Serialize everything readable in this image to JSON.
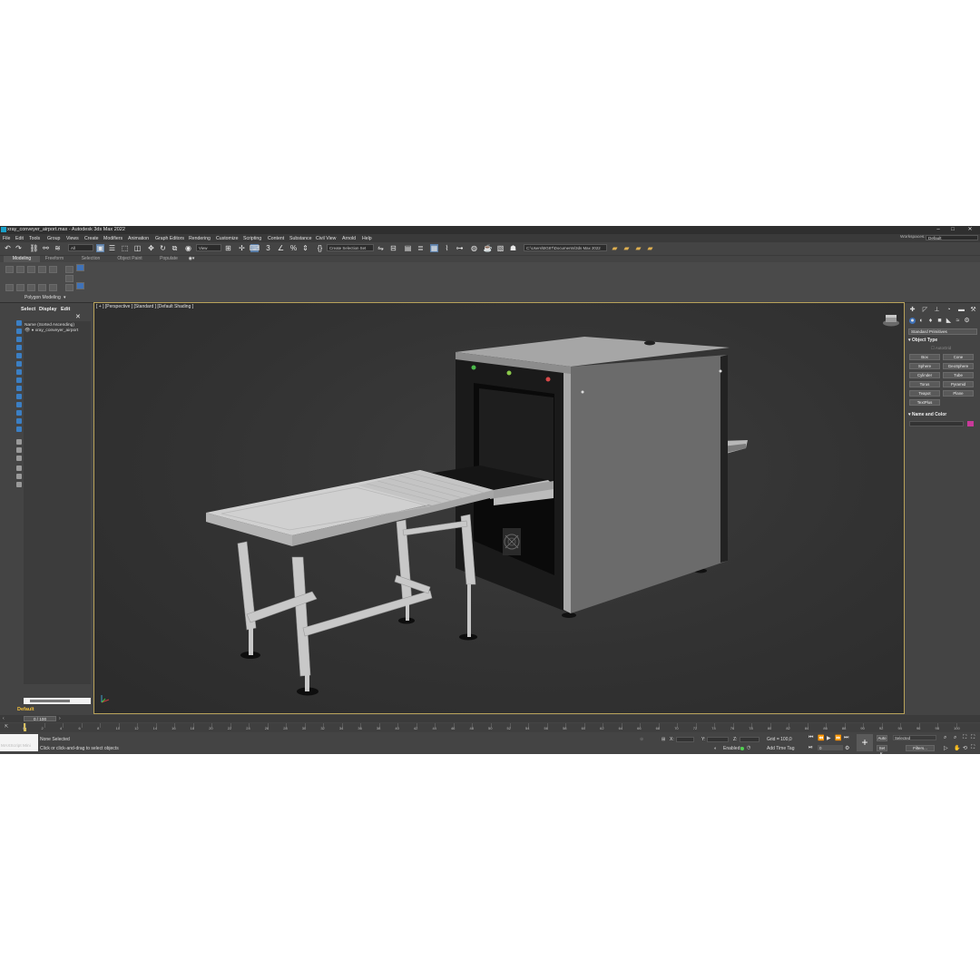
{
  "window": {
    "title": "xray_conveyer_airport.max - Autodesk 3ds Max 2022",
    "controls": [
      "–",
      "□",
      "✕"
    ]
  },
  "menu": {
    "items": [
      "File",
      "Edit",
      "Tools",
      "Group",
      "Views",
      "Create",
      "Modifiers",
      "Animation",
      "Graph Editors",
      "Rendering",
      "Customize",
      "Scripting",
      "Content",
      "Substance",
      "Civil View",
      "Arnold",
      "Help"
    ],
    "workspaces_label": "Workspaces:",
    "workspaces_value": "Default"
  },
  "toolbar": {
    "filter_value": "All",
    "view_value": "View",
    "selection_set": "Create Selection Set",
    "path": "C:\\Users\\BG87\\Documents\\3ds Max 2022"
  },
  "ribbon": {
    "tabs": [
      "Modeling",
      "Freeform",
      "Selection",
      "Object Paint",
      "Populate"
    ],
    "panel_label": "Polygon Modeling"
  },
  "scene_explorer": {
    "tabs": [
      "Select",
      "Display",
      "Edit"
    ],
    "header": "Name (Sorted Ascending)",
    "items": [
      {
        "name": "xray_conveyer_airport"
      }
    ],
    "layer_label": "Default"
  },
  "viewport": {
    "label": "[ + ] [Perspective ] [Standard ] [Default Shading ]"
  },
  "command_panel": {
    "category": "Standard Primitives",
    "object_type_title": "Object Type",
    "autogrid": "AutoGrid",
    "buttons": [
      "Box",
      "Cone",
      "Sphere",
      "GeoSphere",
      "Cylinder",
      "Tube",
      "Torus",
      "Pyramid",
      "Teapot",
      "Plane",
      "TextPlus"
    ],
    "name_color_title": "Name and Color",
    "color": "#c83a9a"
  },
  "timeline": {
    "frame_display": "0 / 100",
    "ticks": [
      "0",
      "2",
      "4",
      "6",
      "8",
      "10",
      "12",
      "14",
      "16",
      "18",
      "20",
      "22",
      "24",
      "26",
      "28",
      "30",
      "32",
      "34",
      "36",
      "38",
      "40",
      "42",
      "44",
      "46",
      "48",
      "50",
      "52",
      "54",
      "56",
      "58",
      "60",
      "62",
      "64",
      "66",
      "68",
      "70",
      "72",
      "74",
      "76",
      "78",
      "80",
      "82",
      "84",
      "86",
      "88",
      "90",
      "92",
      "94",
      "96",
      "98",
      "100"
    ]
  },
  "status": {
    "maxscript": "MAXScript Mini",
    "selection": "None Selected",
    "prompt": "Click or click-and-drag to select objects",
    "x_label": "X:",
    "y_label": "Y:",
    "z_label": "Z:",
    "grid": "Grid = 100,0",
    "enabled": "Enabled:",
    "add_time_tag": "Add Time Tag",
    "auto": "Auto",
    "selected": "Selected",
    "set_k": "Set K.",
    "filters": "Filters...",
    "frame": "0"
  }
}
